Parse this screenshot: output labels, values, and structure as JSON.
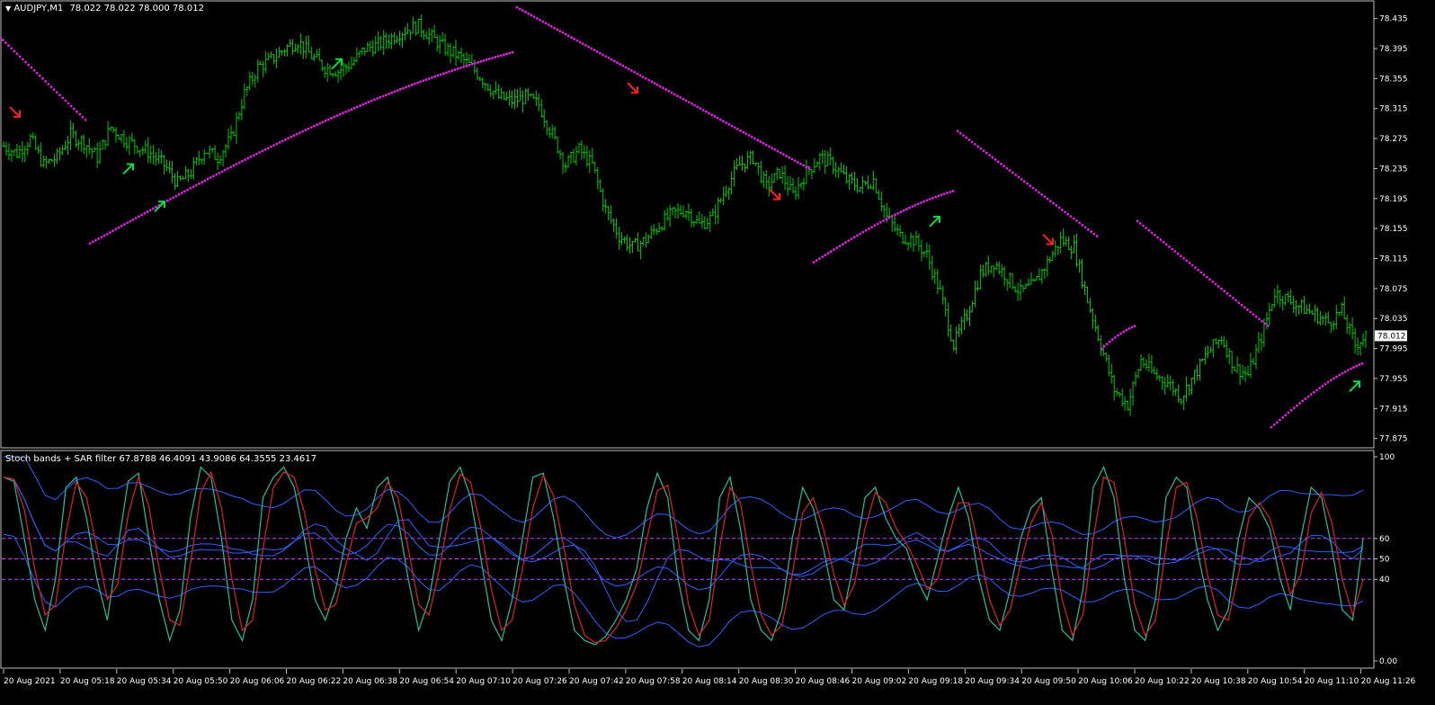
{
  "main_header": {
    "symbol": "AUDJPY,M1",
    "ohlc": "78.022 78.022 78.000 78.012"
  },
  "indicator_header": {
    "name": "Stoch bands + SAR filter",
    "values": "67.8788 46.4091 43.9086 64.3555 23.4617"
  },
  "colors": {
    "background": "#000000",
    "axis": "#c0c0c0",
    "candle": "#00c800",
    "sar": "#e020e0",
    "arrow_up": "#00e040",
    "arrow_down": "#ff2020",
    "stoch_main": "#20c0a0",
    "stoch_signal": "#e02020",
    "bands": "#3060ff",
    "level_lines": "#c040ff"
  },
  "chart_data": [
    {
      "type": "candlestick",
      "title": "AUDJPY,M1",
      "price_scale": [
        "78.435",
        "78.395",
        "78.355",
        "78.315",
        "78.275",
        "78.235",
        "78.195",
        "78.155",
        "78.115",
        "78.075",
        "78.035",
        "77.995",
        "77.955",
        "77.915",
        "77.875"
      ],
      "ylim": [
        77.865,
        78.455
      ],
      "current_price": "78.012",
      "time_labels": [
        "20 Aug 2021",
        "20 Aug 05:18",
        "20 Aug 05:34",
        "20 Aug 05:50",
        "20 Aug 06:06",
        "20 Aug 06:22",
        "20 Aug 06:38",
        "20 Aug 06:54",
        "20 Aug 07:10",
        "20 Aug 07:26",
        "20 Aug 07:42",
        "20 Aug 07:58",
        "20 Aug 08:14",
        "20 Aug 08:30",
        "20 Aug 08:46",
        "20 Aug 09:02",
        "20 Aug 09:18",
        "20 Aug 09:34",
        "20 Aug 09:50",
        "20 Aug 10:06",
        "20 Aug 10:22",
        "20 Aug 10:38",
        "20 Aug 10:54",
        "20 Aug 11:10",
        "20 Aug 11:26"
      ],
      "close_path": [
        [
          0,
          78.265
        ],
        [
          5,
          78.255
        ],
        [
          10,
          78.275
        ],
        [
          15,
          78.24
        ],
        [
          20,
          78.25
        ],
        [
          25,
          78.28
        ],
        [
          30,
          78.27
        ],
        [
          35,
          78.25
        ],
        [
          40,
          78.29
        ],
        [
          45,
          78.275
        ],
        [
          50,
          78.265
        ],
        [
          55,
          78.255
        ],
        [
          60,
          78.24
        ],
        [
          65,
          78.215
        ],
        [
          70,
          78.23
        ],
        [
          75,
          78.26
        ],
        [
          80,
          78.25
        ],
        [
          85,
          78.275
        ],
        [
          90,
          78.335
        ],
        [
          95,
          78.37
        ],
        [
          100,
          78.38
        ],
        [
          105,
          78.395
        ],
        [
          110,
          78.405
        ],
        [
          115,
          78.385
        ],
        [
          120,
          78.37
        ],
        [
          125,
          78.365
        ],
        [
          130,
          78.375
        ],
        [
          135,
          78.395
        ],
        [
          140,
          78.4
        ],
        [
          145,
          78.41
        ],
        [
          150,
          78.42
        ],
        [
          155,
          78.425
        ],
        [
          160,
          78.41
        ],
        [
          165,
          78.395
        ],
        [
          170,
          78.385
        ],
        [
          175,
          78.37
        ],
        [
          180,
          78.35
        ],
        [
          185,
          78.33
        ],
        [
          190,
          78.325
        ],
        [
          195,
          78.33
        ],
        [
          200,
          78.32
        ],
        [
          205,
          78.28
        ],
        [
          210,
          78.24
        ],
        [
          215,
          78.26
        ],
        [
          220,
          78.24
        ],
        [
          225,
          78.18
        ],
        [
          230,
          78.145
        ],
        [
          235,
          78.13
        ],
        [
          240,
          78.14
        ],
        [
          245,
          78.16
        ],
        [
          250,
          78.175
        ],
        [
          255,
          78.18
        ],
        [
          260,
          78.16
        ],
        [
          265,
          78.17
        ],
        [
          270,
          78.21
        ],
        [
          275,
          78.24
        ],
        [
          280,
          78.25
        ],
        [
          285,
          78.21
        ],
        [
          290,
          78.23
        ],
        [
          295,
          78.2
        ],
        [
          300,
          78.23
        ],
        [
          305,
          78.25
        ],
        [
          310,
          78.24
        ],
        [
          315,
          78.22
        ],
        [
          320,
          78.21
        ],
        [
          325,
          78.22
        ],
        [
          330,
          78.17
        ],
        [
          335,
          78.145
        ],
        [
          340,
          78.14
        ],
        [
          345,
          78.12
        ],
        [
          350,
          78.07
        ],
        [
          355,
          78.0
        ],
        [
          360,
          78.04
        ],
        [
          365,
          78.095
        ],
        [
          370,
          78.11
        ],
        [
          375,
          78.09
        ],
        [
          380,
          78.07
        ],
        [
          385,
          78.08
        ],
        [
          390,
          78.11
        ],
        [
          395,
          78.14
        ],
        [
          400,
          78.13
        ],
        [
          405,
          78.06
        ],
        [
          410,
          78.0
        ],
        [
          415,
          77.94
        ],
        [
          420,
          77.92
        ],
        [
          425,
          77.98
        ],
        [
          430,
          77.96
        ],
        [
          435,
          77.95
        ],
        [
          440,
          77.93
        ],
        [
          445,
          77.96
        ],
        [
          450,
          77.99
        ],
        [
          455,
          78.01
        ],
        [
          460,
          77.97
        ],
        [
          465,
          77.96
        ],
        [
          470,
          78.01
        ],
        [
          475,
          78.07
        ],
        [
          480,
          78.06
        ],
        [
          485,
          78.05
        ],
        [
          490,
          78.04
        ],
        [
          495,
          78.03
        ],
        [
          500,
          78.045
        ],
        [
          505,
          78.0
        ],
        [
          509,
          78.012
        ]
      ],
      "sar_segments": [
        {
          "direction": "down",
          "from": [
            0,
            78.41
          ],
          "to": [
            95,
            78.3
          ]
        },
        {
          "direction": "up",
          "from": [
            100,
            78.135
          ],
          "to": [
            570,
            78.39
          ]
        },
        {
          "direction": "down",
          "from": [
            575,
            78.45
          ],
          "to": [
            900,
            78.235
          ]
        },
        {
          "direction": "up",
          "from": [
            905,
            78.11
          ],
          "to": [
            1060,
            78.205
          ]
        },
        {
          "direction": "down",
          "from": [
            1065,
            78.285
          ],
          "to": [
            1220,
            78.145
          ]
        },
        {
          "direction": "up",
          "from": [
            1225,
            77.995
          ],
          "to": [
            1262,
            78.025
          ]
        },
        {
          "direction": "down",
          "from": [
            1265,
            78.165
          ],
          "to": [
            1410,
            78.025
          ]
        },
        {
          "direction": "up",
          "from": [
            1414,
            77.89
          ],
          "to": [
            1515,
            77.975
          ]
        }
      ],
      "arrows": [
        {
          "direction": "down",
          "bar": 17,
          "price": 78.31
        },
        {
          "direction": "up",
          "bar": 143,
          "price": 78.235
        },
        {
          "direction": "up",
          "bar": 178,
          "price": 78.185
        },
        {
          "direction": "up",
          "bar": 375,
          "price": 78.375
        },
        {
          "direction": "down",
          "bar": 704,
          "price": 78.342
        },
        {
          "direction": "down",
          "bar": 862,
          "price": 78.2
        },
        {
          "direction": "up",
          "bar": 1040,
          "price": 78.165
        },
        {
          "direction": "down",
          "bar": 1166,
          "price": 78.14
        },
        {
          "direction": "up",
          "bar": 1507,
          "price": 77.945
        }
      ]
    },
    {
      "type": "line",
      "title": "Stoch bands + SAR filter",
      "ylim": [
        0,
        100
      ],
      "level_lines": [
        60,
        50,
        40
      ],
      "scale_labels": [
        "100",
        "60",
        "50",
        "40",
        "0.00"
      ],
      "series": [
        {
          "values": [
            90,
            88,
            60,
            30,
            15,
            40,
            85,
            90,
            70,
            40,
            20,
            55,
            88,
            92,
            60,
            30,
            10,
            25,
            70,
            95,
            90,
            60,
            20,
            10,
            30,
            80,
            90,
            95,
            85,
            60,
            30,
            20,
            35,
            60,
            75,
            65,
            85,
            90,
            70,
            40,
            15,
            30,
            60,
            88,
            95,
            80,
            50,
            20,
            10,
            30,
            60,
            90,
            92,
            70,
            40,
            15,
            10,
            8,
            12,
            20,
            30,
            45,
            75,
            92,
            80,
            40,
            15,
            10,
            30,
            80,
            90,
            65,
            30,
            15,
            10,
            25,
            60,
            85,
            75,
            55,
            30,
            25,
            50,
            80,
            85,
            70,
            60,
            55,
            40,
            30,
            50,
            70,
            85,
            70,
            40,
            20,
            15,
            35,
            60,
            75,
            80,
            45,
            15,
            10,
            35,
            85,
            95,
            80,
            40,
            15,
            10,
            30,
            80,
            90,
            85,
            55,
            30,
            15,
            25,
            60,
            80,
            75,
            65,
            40,
            25,
            60,
            85,
            80,
            55,
            25,
            20,
            60
          ]
        }
      ]
    }
  ]
}
